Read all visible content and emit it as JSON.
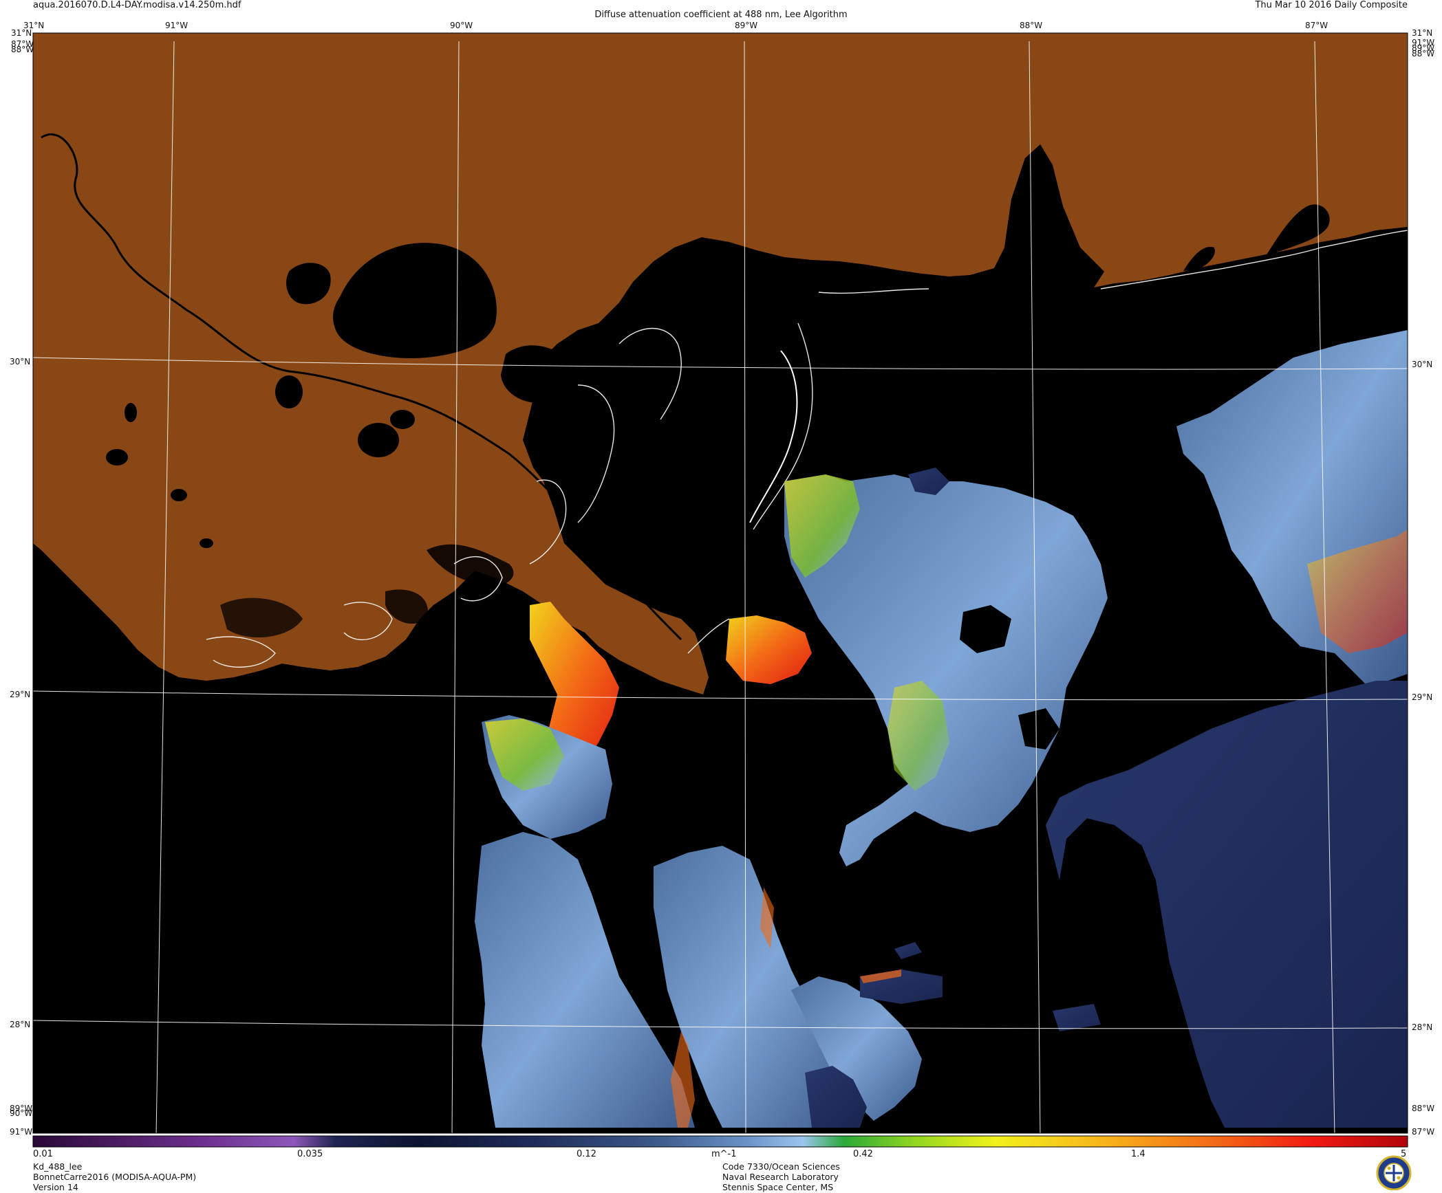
{
  "header": {
    "filename": "aqua.2016070.D.L4-DAY.modisa.v14.250m.hdf",
    "title": "Diffuse attenuation coefficient at 488 nm, Lee Algorithm",
    "date": "Thu Mar 10 2016 Daily Composite"
  },
  "map": {
    "lon_labels": [
      "91°W",
      "90°W",
      "89°W",
      "88°W",
      "87°W"
    ],
    "lat_labels": [
      "30°N",
      "29°N",
      "28°N"
    ],
    "corner_tl": "31°N",
    "corner_tr": "31°N",
    "left_top_stack": [
      "31°N",
      "87°W",
      "88°W"
    ],
    "right_top_stack": [
      "91°W",
      "89°W",
      "88°W"
    ],
    "bottom_left_stack": [
      "89°W",
      "90°W",
      "91°W"
    ],
    "bottom_right_stack": [
      "88°W",
      "87°W"
    ],
    "colors": {
      "land": "#8a4716",
      "water": "#000000",
      "grid": "#ffffff",
      "coast": "#ffffff"
    }
  },
  "colorbar": {
    "ticks": [
      "0.01",
      "0.035",
      "0.12",
      "m^-1",
      "0.42",
      "1.4",
      "5"
    ],
    "min": 0.01,
    "max": 5,
    "scale": "log"
  },
  "footer": {
    "left": [
      "Kd_488_lee",
      "BonnetCarre2016 (MODISA-AQUA-PM)",
      "Version 14"
    ],
    "center": [
      "Code 7330/Ocean Sciences",
      "Naval Research Laboratory",
      "Stennis Space Center, MS"
    ],
    "logo": "NRL seal"
  }
}
